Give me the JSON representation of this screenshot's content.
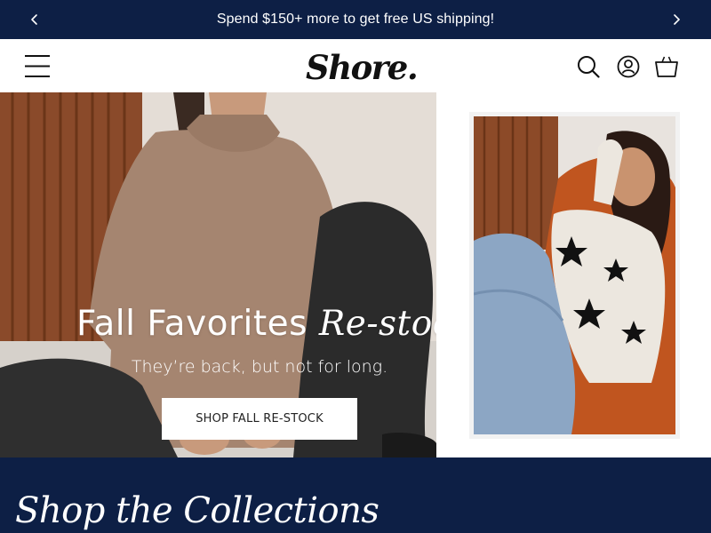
{
  "announcement": {
    "message": "Spend $150+ more to get free US shipping!",
    "prev_icon": "chevron-left-icon",
    "next_icon": "chevron-right-icon"
  },
  "header": {
    "menu_icon": "hamburger-menu-icon",
    "logo_text": "Shore.",
    "icons": [
      "search-icon",
      "account-icon",
      "cart-icon"
    ]
  },
  "hero": {
    "title_main": "Fall Favorites",
    "title_accent": "Re-stocked",
    "subtitle": "They’re back, but not for long.",
    "cta_label": "SHOP FALL RE-STOCK"
  },
  "collections": {
    "heading": "Shop the Collections"
  },
  "colors": {
    "navy": "#0d1f45",
    "white": "#ffffff"
  }
}
